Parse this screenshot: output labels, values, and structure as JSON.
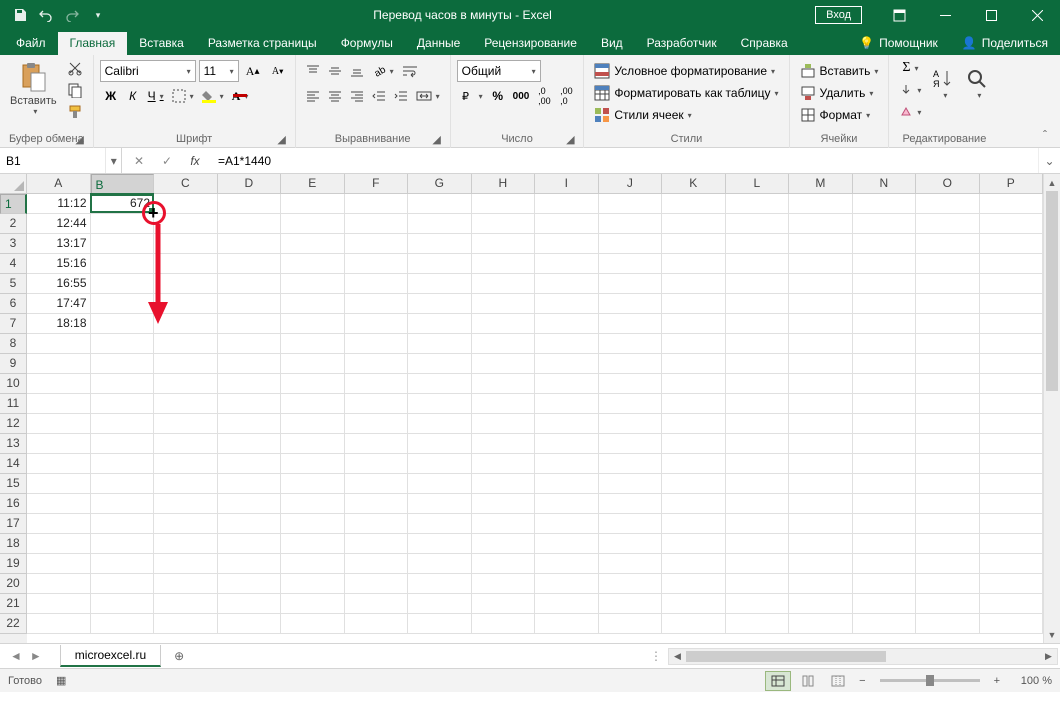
{
  "title": "Перевод часов в минуты  -  Excel",
  "login": "Вход",
  "tabs": {
    "file": "Файл",
    "home": "Главная",
    "insert": "Вставка",
    "page_layout": "Разметка страницы",
    "formulas": "Формулы",
    "data": "Данные",
    "review": "Рецензирование",
    "view": "Вид",
    "developer": "Разработчик",
    "help": "Справка",
    "tell_me": "Помощник",
    "share": "Поделиться"
  },
  "ribbon": {
    "clipboard": {
      "label": "Буфер обмена",
      "paste": "Вставить"
    },
    "font": {
      "label": "Шрифт",
      "name": "Calibri",
      "size": "11",
      "bold": "Ж",
      "italic": "К",
      "underline": "Ч"
    },
    "alignment": {
      "label": "Выравнивание"
    },
    "number": {
      "label": "Число",
      "format": "Общий"
    },
    "styles": {
      "label": "Стили",
      "cond_fmt": "Условное форматирование",
      "as_table": "Форматировать как таблицу",
      "cell_styles": "Стили ячеек"
    },
    "cells": {
      "label": "Ячейки",
      "insert": "Вставить",
      "delete": "Удалить",
      "format": "Формат"
    },
    "editing": {
      "label": "Редактирование"
    }
  },
  "namebox": "B1",
  "formula": "=A1*1440",
  "columns": [
    "A",
    "B",
    "C",
    "D",
    "E",
    "F",
    "G",
    "H",
    "I",
    "J",
    "K",
    "L",
    "M",
    "N",
    "O",
    "P"
  ],
  "rows": [
    "1",
    "2",
    "3",
    "4",
    "5",
    "6",
    "7",
    "8",
    "9",
    "10",
    "11",
    "12",
    "13",
    "14",
    "15",
    "16",
    "17",
    "18",
    "19",
    "20",
    "21",
    "22"
  ],
  "data": {
    "A": [
      "11:12",
      "12:44",
      "13:17",
      "15:16",
      "16:55",
      "17:47",
      "18:18"
    ],
    "B": [
      "672"
    ]
  },
  "active": {
    "col": 1,
    "row": 0
  },
  "sheet": "microexcel.ru",
  "status": "Готово",
  "zoom": "100 %"
}
